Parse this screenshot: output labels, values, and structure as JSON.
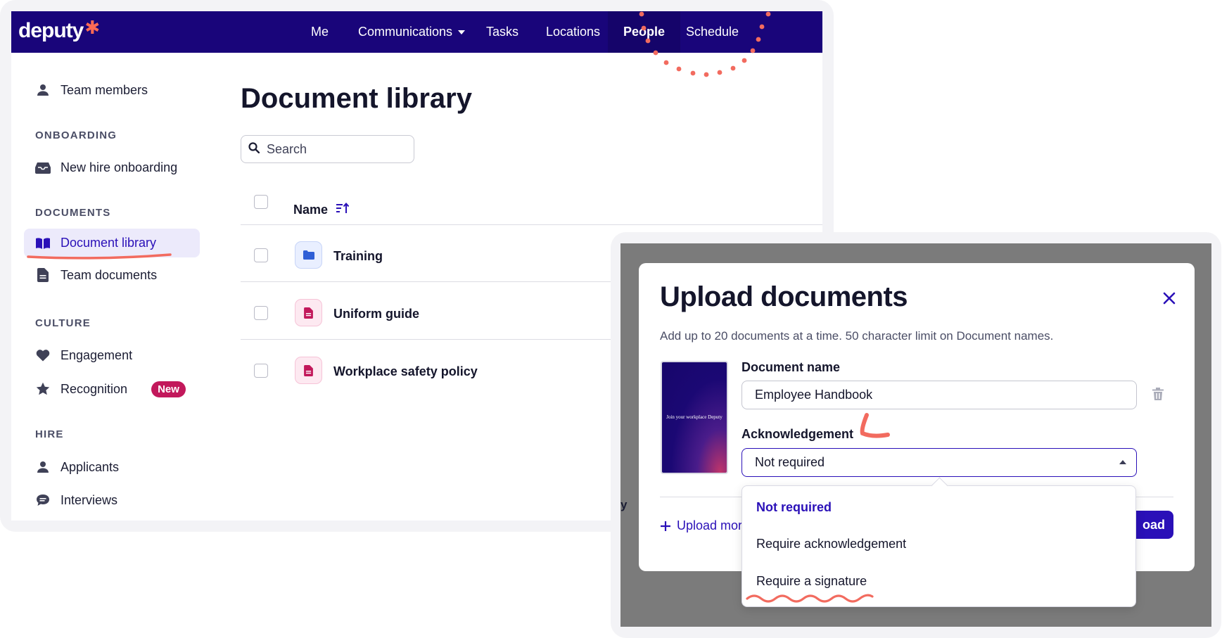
{
  "brand": {
    "logo": "deputy",
    "logo_mark": "✱"
  },
  "topnav": {
    "items": [
      "Me",
      "Communications",
      "Tasks",
      "Locations",
      "People",
      "Schedule"
    ],
    "active": "People"
  },
  "sidebar": {
    "team_members": "Team members",
    "sections": {
      "onboarding": "ONBOARDING",
      "documents": "DOCUMENTS",
      "culture": "CULTURE",
      "hire": "HIRE"
    },
    "new_hire_onboarding": "New hire onboarding",
    "document_library": "Document library",
    "team_documents": "Team documents",
    "engagement": "Engagement",
    "recognition": "Recognition",
    "recognition_badge": "New",
    "applicants": "Applicants",
    "interviews": "Interviews"
  },
  "main": {
    "title": "Document library",
    "search": {
      "placeholder": "Search",
      "value": ""
    },
    "column_name": "Name",
    "rows": [
      {
        "label": "Training",
        "kind": "folder"
      },
      {
        "label": "Uniform guide",
        "kind": "document"
      },
      {
        "label": "Workplace safety policy",
        "kind": "document"
      }
    ]
  },
  "modal": {
    "title": "Upload documents",
    "hint": "Add up to 20 documents at a time. 50 character limit on Document names.",
    "thumbnail_text": "Join your workplace Deputy",
    "document_name_label": "Document name",
    "document_name_value": "Employee Handbook",
    "acknowledgement_label": "Acknowledgement",
    "acknowledgement_value": "Not required",
    "options": [
      "Not required",
      "Require acknowledgement",
      "Require a signature"
    ],
    "upload_more": "Upload mor",
    "upload_button": "oad",
    "background_fragment": "y"
  },
  "colors": {
    "nav_bg": "#19057a",
    "accent": "#2a10b8",
    "badge": "#c2185b",
    "annotation": "#f26b5f"
  }
}
